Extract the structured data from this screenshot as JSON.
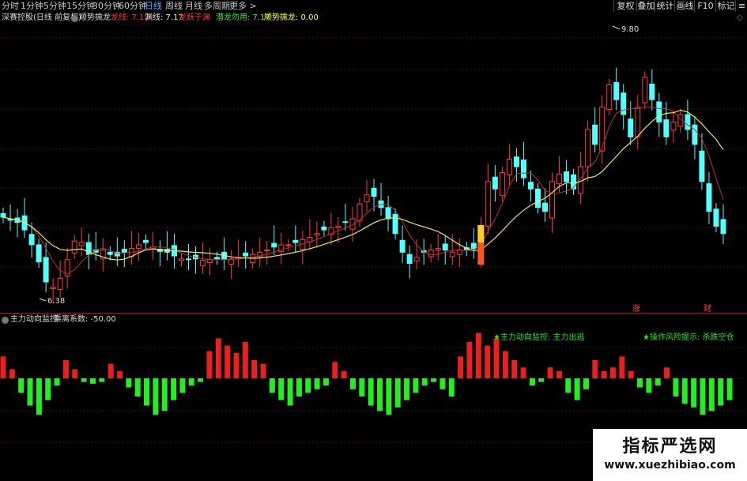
{
  "toolbar": {
    "timeframes": [
      "分时",
      "1分钟",
      "5分钟",
      "15分钟",
      "30分钟",
      "60分钟",
      "日线",
      "周线",
      "月线",
      "多周期",
      "更多 >"
    ],
    "active": "日线",
    "right_buttons": [
      "复权",
      "叠加",
      "统计",
      "画线",
      "F10",
      "标记"
    ]
  },
  "legend": {
    "stock_name": "深赛控股(日线 前复权)",
    "indicator_name": "顺势擒龙",
    "items": [
      {
        "label": "龙线: 7.17",
        "color": "#ff3b3b"
      },
      {
        "label": "渊线: 7.17",
        "color": "#e8e8e8"
      },
      {
        "label": "龙跃于渊",
        "color": "#ff3b3b"
      },
      {
        "label": "潜龙勿用: 7.17",
        "color": "#3ee83e"
      },
      {
        "label": "顺势擒龙: 0.00",
        "color": "#ffff55"
      }
    ]
  },
  "price_panel": {
    "high_label": "9.80",
    "low_label": "6.38",
    "marker_zhang": "涨",
    "marker_cai": "财"
  },
  "sub_panel": {
    "title": "主力动向监控",
    "coef": "乘离系数: -50.00",
    "signal_1": "★主力动向监控: 主力出逃",
    "signal_2": "★操作风险提示: 杀跌空仓"
  },
  "watermark": {
    "line1": "指标严选网",
    "line2": "www.xuezhibiao.com"
  },
  "chart_data": {
    "type": "candlestick",
    "price_range": [
      6.2,
      10.0
    ],
    "closes": [
      7.42,
      7.38,
      7.35,
      7.25,
      7.05,
      6.82,
      6.55,
      6.48,
      6.6,
      6.85,
      7.1,
      7.08,
      6.92,
      6.95,
      6.98,
      6.92,
      6.9,
      6.95,
      7.0,
      7.05,
      7.08,
      7.02,
      6.96,
      6.95,
      6.9,
      6.86,
      6.85,
      6.86,
      6.84,
      6.85,
      6.86,
      6.85,
      6.86,
      6.88,
      6.9,
      6.92,
      6.95,
      6.98,
      7.02,
      7.05,
      7.05,
      7.08,
      7.12,
      7.15,
      7.2,
      7.25,
      7.28,
      7.3,
      7.35,
      7.4,
      7.6,
      7.72,
      7.7,
      7.55,
      7.4,
      7.2,
      6.95,
      6.8,
      6.88,
      6.95,
      6.98,
      7.0,
      6.98,
      6.95,
      6.98,
      6.98,
      7.0,
      7.3,
      7.9,
      7.8,
      8.02,
      8.2,
      8.1,
      7.95,
      7.8,
      7.55,
      7.5,
      7.9,
      8.0,
      7.9,
      7.8,
      8.1,
      8.6,
      8.4,
      8.9,
      9.2,
      9.0,
      8.8,
      8.5,
      8.9,
      9.3,
      9.0,
      8.7,
      8.5,
      8.7,
      8.8,
      8.6,
      8.4,
      7.9,
      7.5,
      7.3,
      7.2
    ],
    "histogram": [
      12,
      5,
      -8,
      -15,
      -20,
      -12,
      -4,
      10,
      5,
      -2,
      -3,
      -2,
      8,
      4,
      -5,
      -10,
      -15,
      -20,
      -18,
      -12,
      -8,
      -4,
      -2,
      15,
      22,
      18,
      14,
      20,
      10,
      8,
      -8,
      -12,
      -15,
      -10,
      -8,
      -6,
      -4,
      9,
      4,
      -6,
      -10,
      -15,
      -18,
      -20,
      -16,
      -12,
      -8,
      -4,
      -2,
      -6,
      -10,
      12,
      20,
      25,
      18,
      22,
      15,
      10,
      6,
      -4,
      -2,
      6,
      4,
      -8,
      -12,
      -6,
      10,
      4,
      6,
      12,
      4,
      -5,
      -8,
      -4,
      6,
      -10,
      -14,
      -16,
      -20,
      -18,
      -15,
      -12
    ],
    "ma_series": [
      "龙线",
      "渊线",
      "潜龙勿用"
    ]
  }
}
